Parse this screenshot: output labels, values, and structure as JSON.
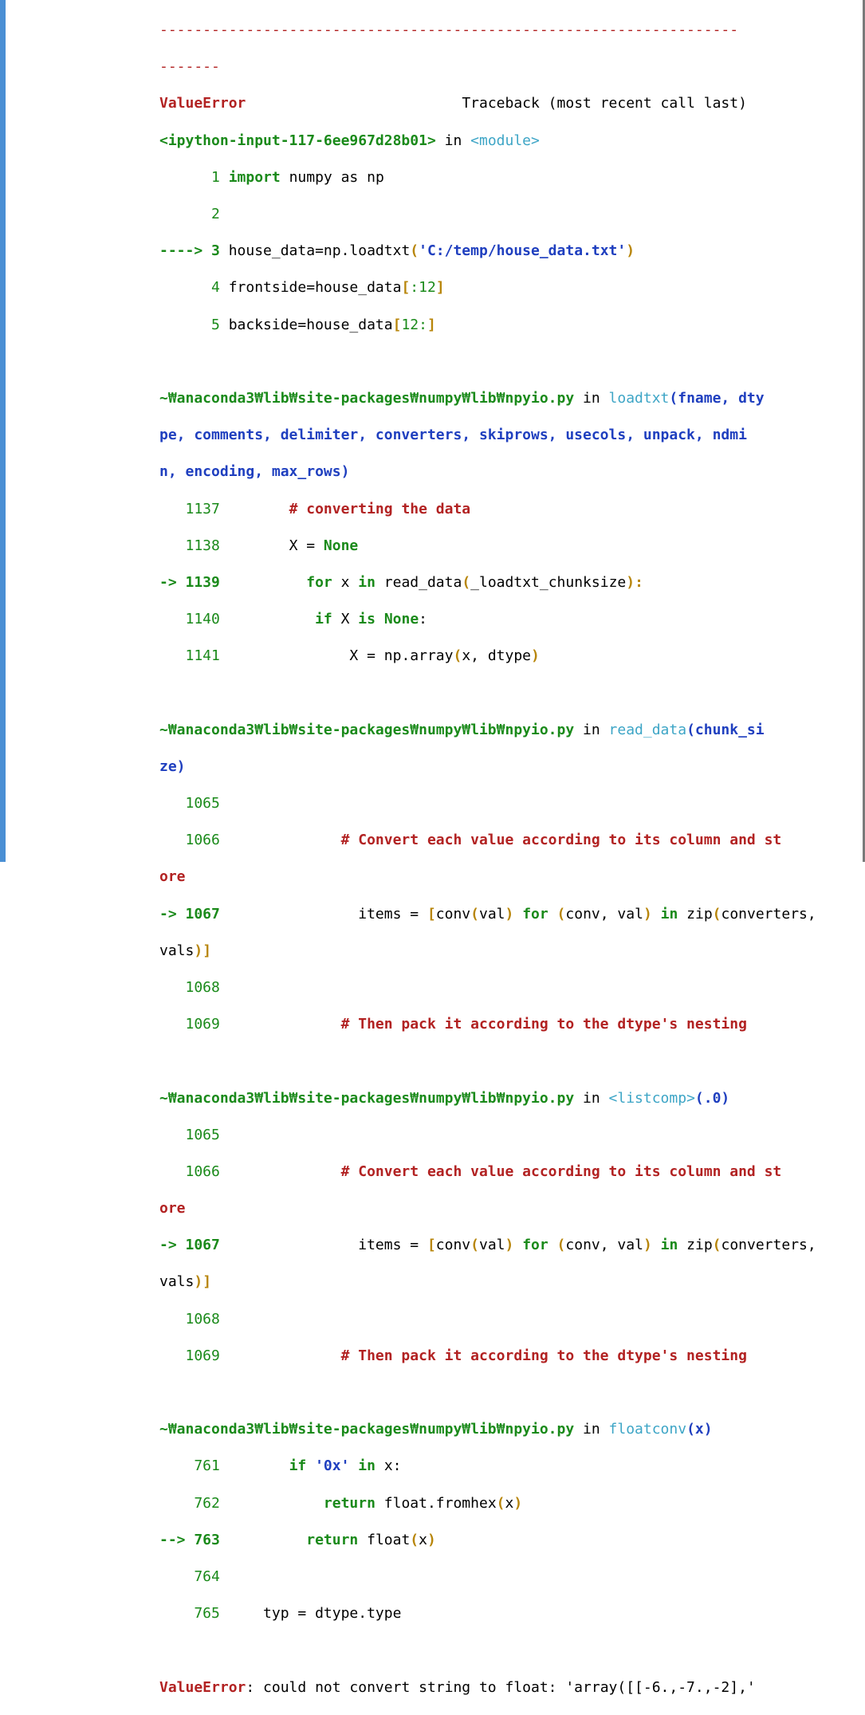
{
  "traceback": {
    "separator_1": "-------------------------------------------------------------------",
    "separator_2": "-------",
    "error_name": "ValueError",
    "header_right": "Traceback (most recent call last)",
    "input_cell": "<ipython-input-117-6ee967d28b01>",
    "in_word": " in ",
    "module": "<module>",
    "frame1": [
      {
        "num": "      1 ",
        "code_kw": "import",
        "code": " numpy as np"
      },
      {
        "num": "      2",
        "code_kw": "",
        "code": ""
      },
      {
        "num": "----> 3 ",
        "code_pre": "house_data=np.loadtxt",
        "paren_open": "(",
        "str": "'C:/temp/house_data.txt'",
        "paren_close": ")"
      },
      {
        "num": "      4 ",
        "code_pre": "frontside=house_data",
        "br_open": "[",
        "inner": ":12",
        "br_close": "]"
      },
      {
        "num": "      5 ",
        "code_pre": "backside=house_data",
        "br_open": "[",
        "inner": "12:",
        "br_close": "]"
      }
    ],
    "frame2_path": "~₩anaconda3₩lib₩site-packages₩numpy₩lib₩npyio.py",
    "frame2_func": "loadtxt",
    "frame2_args_1": "(fname, dty",
    "frame2_args_2": "pe, comments, delimiter, converters, skiprows, usecols, unpack, ndmi",
    "frame2_args_3": "n, encoding, max_rows)",
    "frame2_lines": [
      {
        "num": "   1137",
        "pad": "        ",
        "comment": "# converting the data"
      },
      {
        "num": "   1138",
        "pad": "        ",
        "code": "X = ",
        "kw": "None"
      },
      {
        "num": "-> 1139",
        "pad": "          ",
        "kw": "for",
        "code": " x ",
        "kw2": "in",
        "code2": " read_data",
        "p1": "(",
        "code3": "_loadtxt_chunksize",
        "p2": "):"
      },
      {
        "num": "   1140",
        "pad": "           ",
        "kw": "if",
        "code": " X ",
        "kw2": "is",
        "code2": " ",
        "kw3": "None",
        "code3": ":"
      },
      {
        "num": "   1141",
        "pad": "               ",
        "code": "X = np.array",
        "p1": "(",
        "code2": "x, dtype",
        "p2": ")"
      }
    ],
    "frame3_path": "~₩anaconda3₩lib₩site-packages₩numpy₩lib₩npyio.py",
    "frame3_func": "read_data",
    "frame3_args_1": "(chunk_si",
    "frame3_args_2": "ze)",
    "frame4_path": "~₩anaconda3₩lib₩site-packages₩numpy₩lib₩npyio.py",
    "frame4_func": "<listcomp>",
    "frame4_args": "(.0)",
    "comp_lines": {
      "l1065": "   1065",
      "l1066": "   1066",
      "pad1066": "              ",
      "comment1": "# Convert each value according to its column and st",
      "comment1b": "ore",
      "l1067": "-> 1067",
      "pad1067": "                ",
      "items_pre": "items = ",
      "br_open": "[",
      "conv1": "conv",
      "p_o": "(",
      "val": "val",
      "p_c": ")",
      "for_kw": " for ",
      "tuple_open": "(",
      "tuple": "conv, val",
      "tuple_close": ")",
      "in_kw": " in ",
      "zip": "zip",
      "zip_args": "converters,",
      "vals_line": "vals",
      "vals_close": ")]",
      "l1068": "   1068",
      "l1069": "   1069",
      "pad1069": "              ",
      "comment2": "# Then pack it according to the dtype's nesting"
    },
    "frame5_path": "~₩anaconda3₩lib₩site-packages₩numpy₩lib₩npyio.py",
    "frame5_func": "floatconv",
    "frame5_args": "(x)",
    "frame5_lines": {
      "l761": "    761",
      "pad761": "        ",
      "if_kw": "if",
      "str_0x": "'0x'",
      "in_kw": "in",
      "x_colon": " x:",
      "l762": "    762",
      "pad762": "            ",
      "return_kw": "return",
      "fromhex": " float.fromhex",
      "fh_open": "(",
      "fh_x": "x",
      "fh_close": ")",
      "l763": "--> 763",
      "pad763": "          ",
      "float_call": " float",
      "fc_open": "(",
      "fc_x": "x",
      "fc_close": ")",
      "l764": "    764",
      "l765": "    765",
      "pad765": "     ",
      "typ_line": "typ = dtype.type"
    },
    "final_error_name": "ValueError",
    "final_error_msg": ": could not convert string to float: 'array([[-6.,-7.,-2],'"
  }
}
